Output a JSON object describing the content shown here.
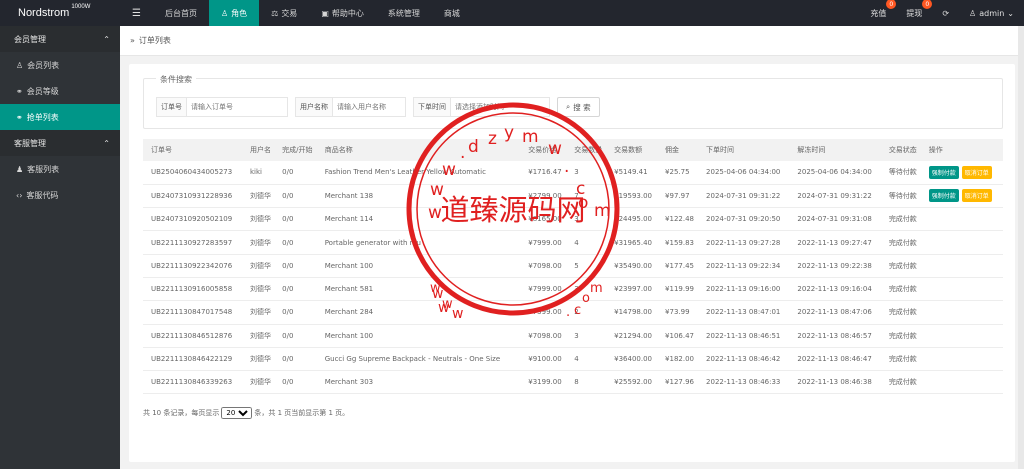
{
  "brand": {
    "name": "Nordstrom",
    "sup": "1000W"
  },
  "nav": [
    {
      "label": "后台首页",
      "icon": ""
    },
    {
      "label": "角色",
      "icon": "user-icon"
    },
    {
      "label": "交易",
      "icon": "scale-icon"
    },
    {
      "label": "帮助中心",
      "icon": "help-icon"
    },
    {
      "label": "系统管理",
      "icon": ""
    },
    {
      "label": "商城",
      "icon": ""
    }
  ],
  "topright": {
    "recharge": "充值",
    "recharge_count": "0",
    "withdraw": "提现",
    "withdraw_count": "0",
    "user": "admin"
  },
  "sidebar": {
    "group1": "会员管理",
    "items1": [
      "会员列表",
      "会员等级",
      "抢单列表"
    ],
    "group2": "客服管理",
    "items2": [
      "客服列表",
      "客服代码"
    ]
  },
  "breadcrumb": "订单列表",
  "search": {
    "legend": "条件搜索",
    "order_label": "订单号",
    "order_placeholder": "请输入订单号",
    "user_label": "用户名称",
    "user_placeholder": "请输入用户名称",
    "time_label": "下单时间",
    "time_placeholder": "请选择添加时间",
    "button": "搜 索"
  },
  "table": {
    "headers": [
      "订单号",
      "用户名",
      "完成/开始",
      "商品名称",
      "交易价格",
      "交易数量",
      "交易数额",
      "佣金",
      "下单时间",
      "解冻时间",
      "交易状态",
      "操作"
    ],
    "rows": [
      [
        "UB2504060434005273",
        "kiki",
        "0/0",
        "Fashion Trend Men's Leather Yellow Automatic",
        "¥1716.47",
        "3",
        "¥5149.41",
        "¥25.75",
        "2025-04-06 04:34:00",
        "2025-04-06 04:34:00",
        "等待付款"
      ],
      [
        "UB2407310931228936",
        "刘德华",
        "0/0",
        "Merchant 138",
        "¥2799.00",
        "7",
        "¥19593.00",
        "¥97.97",
        "2024-07-31 09:31:22",
        "2024-07-31 09:31:22",
        "等待付款"
      ],
      [
        "UB2407310920502109",
        "刘德华",
        "0/0",
        "Merchant 114",
        "¥8165.00",
        "3",
        "¥24495.00",
        "¥122.48",
        "2024-07-31 09:20:50",
        "2024-07-31 09:31:08",
        "完成付款"
      ],
      [
        "UB2211130927283597",
        "刘德华",
        "0/0",
        "Portable generator with mu",
        "¥7999.00",
        "4",
        "¥31965.40",
        "¥159.83",
        "2022-11-13 09:27:28",
        "2022-11-13 09:27:47",
        "完成付款"
      ],
      [
        "UB2211130922342076",
        "刘德华",
        "0/0",
        "Merchant 100",
        "¥7098.00",
        "5",
        "¥35490.00",
        "¥177.45",
        "2022-11-13 09:22:34",
        "2022-11-13 09:22:38",
        "完成付款"
      ],
      [
        "UB2211130916005858",
        "刘德华",
        "0/0",
        "Merchant 581",
        "¥7999.00",
        "3",
        "¥23997.00",
        "¥119.99",
        "2022-11-13 09:16:00",
        "2022-11-13 09:16:04",
        "完成付款"
      ],
      [
        "UB2211130847017548",
        "刘德华",
        "0/0",
        "Merchant 284",
        "¥7399.00",
        "2",
        "¥14798.00",
        "¥73.99",
        "2022-11-13 08:47:01",
        "2022-11-13 08:47:06",
        "完成付款"
      ],
      [
        "UB2211130846512876",
        "刘德华",
        "0/0",
        "Merchant 100",
        "¥7098.00",
        "3",
        "¥21294.00",
        "¥106.47",
        "2022-11-13 08:46:51",
        "2022-11-13 08:46:57",
        "完成付款"
      ],
      [
        "UB2211130846422129",
        "刘德华",
        "0/0",
        "Gucci Gg Supreme Backpack - Neutrals - One Size",
        "¥9100.00",
        "4",
        "¥36400.00",
        "¥182.00",
        "2022-11-13 08:46:42",
        "2022-11-13 08:46:47",
        "完成付款"
      ],
      [
        "UB2211130846339263",
        "刘德华",
        "0/0",
        "Merchant 303",
        "¥3199.00",
        "8",
        "¥25592.00",
        "¥127.96",
        "2022-11-13 08:46:33",
        "2022-11-13 08:46:38",
        "完成付款"
      ]
    ],
    "op_pay": "强制付款",
    "op_cancel": "取消订单"
  },
  "pager": {
    "prefix": "共 10 条记录，每页显示",
    "per_page": "20",
    "suffix": "条，共 1 页当前显示第 1 页。"
  },
  "watermark": {
    "text": "道臻源码网",
    "url": "www.dzym.com"
  },
  "colors": {
    "accent": "#009688",
    "warning": "#ffb800",
    "topbar": "#23262e",
    "sidebar": "#2f3337",
    "stamp": "#e02020"
  }
}
